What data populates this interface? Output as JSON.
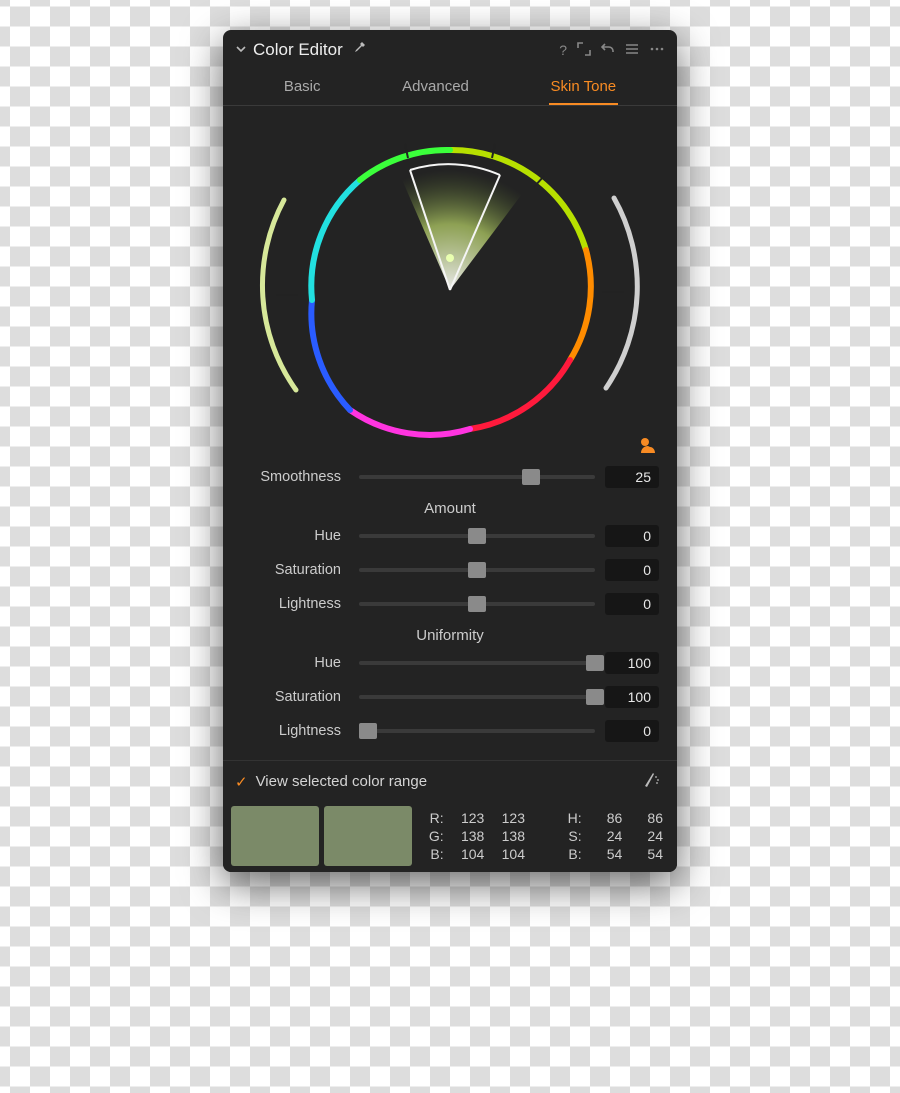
{
  "accent_color": "#f88b23",
  "header": {
    "title": "Color Editor",
    "icons": {
      "help": "?",
      "expand": "expand-icon",
      "undo": "undo-icon",
      "menu": "menu-icon",
      "more": "more-icon"
    }
  },
  "tabs": {
    "items": [
      "Basic",
      "Advanced",
      "Skin Tone"
    ],
    "active_index": 2
  },
  "sliders": {
    "smoothness": {
      "label": "Smoothness",
      "value": 25,
      "display": "25",
      "percent": 73
    },
    "amount": {
      "title": "Amount",
      "hue": {
        "label": "Hue",
        "value": 0,
        "display": "0",
        "percent": 50
      },
      "saturation": {
        "label": "Saturation",
        "value": 0,
        "display": "0",
        "percent": 50
      },
      "lightness": {
        "label": "Lightness",
        "value": 0,
        "display": "0",
        "percent": 50
      }
    },
    "uniformity": {
      "title": "Uniformity",
      "hue": {
        "label": "Hue",
        "value": 100,
        "display": "100",
        "percent": 100
      },
      "saturation": {
        "label": "Saturation",
        "value": 100,
        "display": "100",
        "percent": 100
      },
      "lightness": {
        "label": "Lightness",
        "value": 0,
        "display": "0",
        "percent": 4
      }
    }
  },
  "footer": {
    "checkbox_checked": true,
    "checkbox_label": "View selected color range"
  },
  "swatches": {
    "color1": "#7b8a68",
    "color2": "#7b8a68",
    "rgb": {
      "r": [
        123,
        123
      ],
      "g": [
        138,
        138
      ],
      "b": [
        104,
        104
      ]
    },
    "hsb": {
      "h": [
        86,
        86
      ],
      "s": [
        24,
        24
      ],
      "b": [
        54,
        54
      ]
    },
    "labels": {
      "R": "R:",
      "G": "G:",
      "B": "B:",
      "H": "H:",
      "S": "S:",
      "B2": "B:"
    }
  }
}
